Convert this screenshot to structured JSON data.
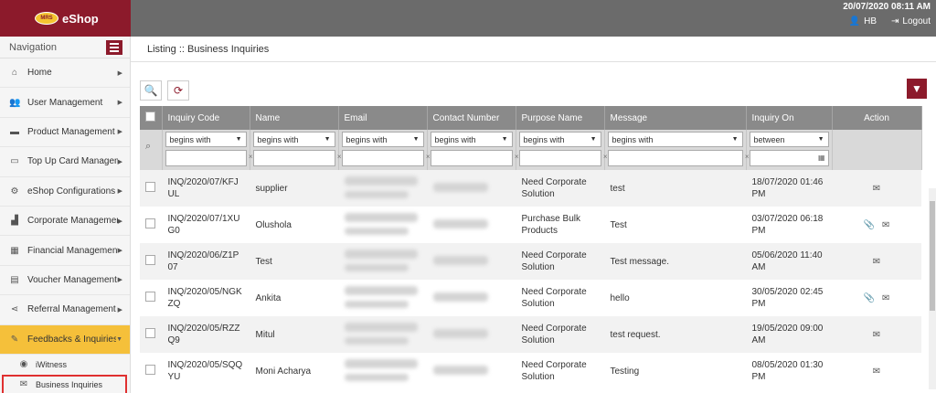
{
  "brand": {
    "logo_text": "MRS",
    "name": "eShop"
  },
  "header": {
    "datetime": "20/07/2020 08:11 AM",
    "user": "HB",
    "logout": "Logout"
  },
  "sidebar": {
    "title": "Navigation",
    "items": [
      {
        "label": "Home",
        "icon": "home-icon"
      },
      {
        "label": "User Management",
        "icon": "users-icon"
      },
      {
        "label": "Product Management",
        "icon": "box-icon"
      },
      {
        "label": "Top Up Card Management",
        "icon": "card-icon"
      },
      {
        "label": "eShop Configurations",
        "icon": "gear-icon"
      },
      {
        "label": "Corporate Management",
        "icon": "chart-icon"
      },
      {
        "label": "Financial Management",
        "icon": "grid-icon"
      },
      {
        "label": "Voucher Management",
        "icon": "voucher-icon"
      },
      {
        "label": "Referral Management",
        "icon": "share-icon"
      },
      {
        "label": "Feedbacks & Inquiries",
        "icon": "edit-icon"
      }
    ],
    "sub_items": [
      {
        "label": "iWitness",
        "icon": "eye-icon"
      },
      {
        "label": "Business Inquiries",
        "icon": "envelope-icon"
      }
    ]
  },
  "breadcrumb": "Listing :: Business Inquiries",
  "table": {
    "columns": [
      "Inquiry Code",
      "Name",
      "Email",
      "Contact Number",
      "Purpose Name",
      "Message",
      "Inquiry On",
      "Action"
    ],
    "filters": [
      "begins with",
      "begins with",
      "begins with",
      "begins with",
      "begins with",
      "begins with",
      "between"
    ],
    "rows": [
      {
        "code": "INQ/2020/07/KFJUL",
        "name": "supplier",
        "purpose": "Need Corporate Solution",
        "message": "test",
        "date": "18/07/2020 01:46 PM",
        "attachment": false
      },
      {
        "code": "INQ/2020/07/1XUG0",
        "name": "Olushola",
        "purpose": "Purchase Bulk Products",
        "message": "Test",
        "date": "03/07/2020 06:18 PM",
        "attachment": true
      },
      {
        "code": "INQ/2020/06/Z1P07",
        "name": "Test",
        "purpose": "Need Corporate Solution",
        "message": "Test message.",
        "date": "05/06/2020 11:40 AM",
        "attachment": false
      },
      {
        "code": "INQ/2020/05/NGKZQ",
        "name": "Ankita",
        "purpose": "Need Corporate Solution",
        "message": "hello",
        "date": "30/05/2020 02:45 PM",
        "attachment": true
      },
      {
        "code": "INQ/2020/05/RZZQ9",
        "name": "Mitul",
        "purpose": "Need Corporate Solution",
        "message": "test request.",
        "date": "19/05/2020 09:00 AM",
        "attachment": false
      },
      {
        "code": "INQ/2020/05/SQQYU",
        "name": "Moni Acharya",
        "purpose": "Need Corporate Solution",
        "message": "Testing",
        "date": "08/05/2020 01:30 PM",
        "attachment": false
      }
    ]
  }
}
